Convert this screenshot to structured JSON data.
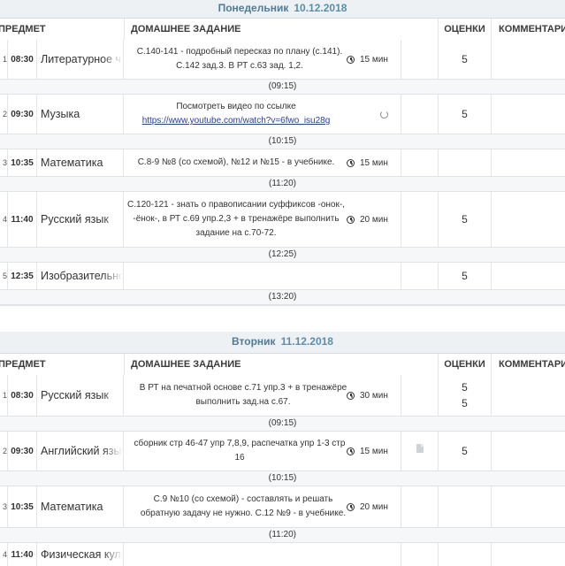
{
  "columns": {
    "subject": "ПРЕДМЕТ",
    "homework": "ДОМАШНЕЕ ЗАДАНИЕ",
    "grades": "ОЦЕНКИ",
    "comments": "КОММЕНТАРИ"
  },
  "days": [
    {
      "weekday": "Понедельник",
      "date": "10.12.2018",
      "lessons": [
        {
          "num": "1",
          "time": "08:30",
          "subject": "Литературное чтение",
          "homework": "С.140-141 - подробный пересказ по плану (с.141). С.142 зад.3. В РТ с.63 зад. 1,2.",
          "duration": "15 мин",
          "grades": [
            "5"
          ],
          "break": "(09:15)"
        },
        {
          "num": "2",
          "time": "09:30",
          "subject": "Музыка",
          "homework": "Посмотреть видео по ссылке",
          "link": "https://www.youtube.com/watch?v=6fwo_isu28g",
          "duration": "",
          "grades": [
            "5"
          ],
          "break": "(10:15)"
        },
        {
          "num": "3",
          "time": "10:35",
          "subject": "Математика",
          "homework": "С.8-9 №8 (со схемой), №12 и №15 - в учебнике.",
          "duration": "15 мин",
          "grades": [],
          "break": "(11:20)"
        },
        {
          "num": "4",
          "time": "11:40",
          "subject": "Русский язык",
          "homework": "С.120-121 - знать о правописании суффиксов -онок-, -ёнок-, в РТ с.69 упр.2,3 + в тренажёре выполнить задание на с.70-72.",
          "duration": "20 мин",
          "grades": [
            "5"
          ],
          "break": "(12:25)"
        },
        {
          "num": "5",
          "time": "12:35",
          "subject": "Изобразительное искусство",
          "homework": "",
          "duration": "",
          "grades": [
            "5"
          ],
          "break": "(13:20)"
        }
      ]
    },
    {
      "weekday": "Вторник",
      "date": "11.12.2018",
      "lessons": [
        {
          "num": "1",
          "time": "08:30",
          "subject": "Русский язык",
          "homework": "В РТ на печатной основе с.71 упр.3 + в тренажёре выполнить зад.на с.67.",
          "duration": "30 мин",
          "grades": [
            "5",
            "5"
          ],
          "break": "(09:15)"
        },
        {
          "num": "2",
          "time": "09:30",
          "subject": "Английский язык",
          "homework": "сборник стр 46-47 упр 7,8,9, распечатка упр 1-3 стр 16",
          "duration": "15 мин",
          "grades": [
            "5"
          ],
          "break": "(10:15)"
        },
        {
          "num": "3",
          "time": "10:35",
          "subject": "Математика",
          "homework": "С.9 №10 (со схемой) - составлять и решать обратную задачу не нужно. С.12 №9 - в учебнике.",
          "duration": "20 мин",
          "grades": [],
          "break": "(11:20)"
        },
        {
          "num": "4",
          "time": "11:40",
          "subject": "Физическая культура",
          "homework": "",
          "duration": "",
          "grades": [],
          "break": ""
        }
      ]
    }
  ]
}
